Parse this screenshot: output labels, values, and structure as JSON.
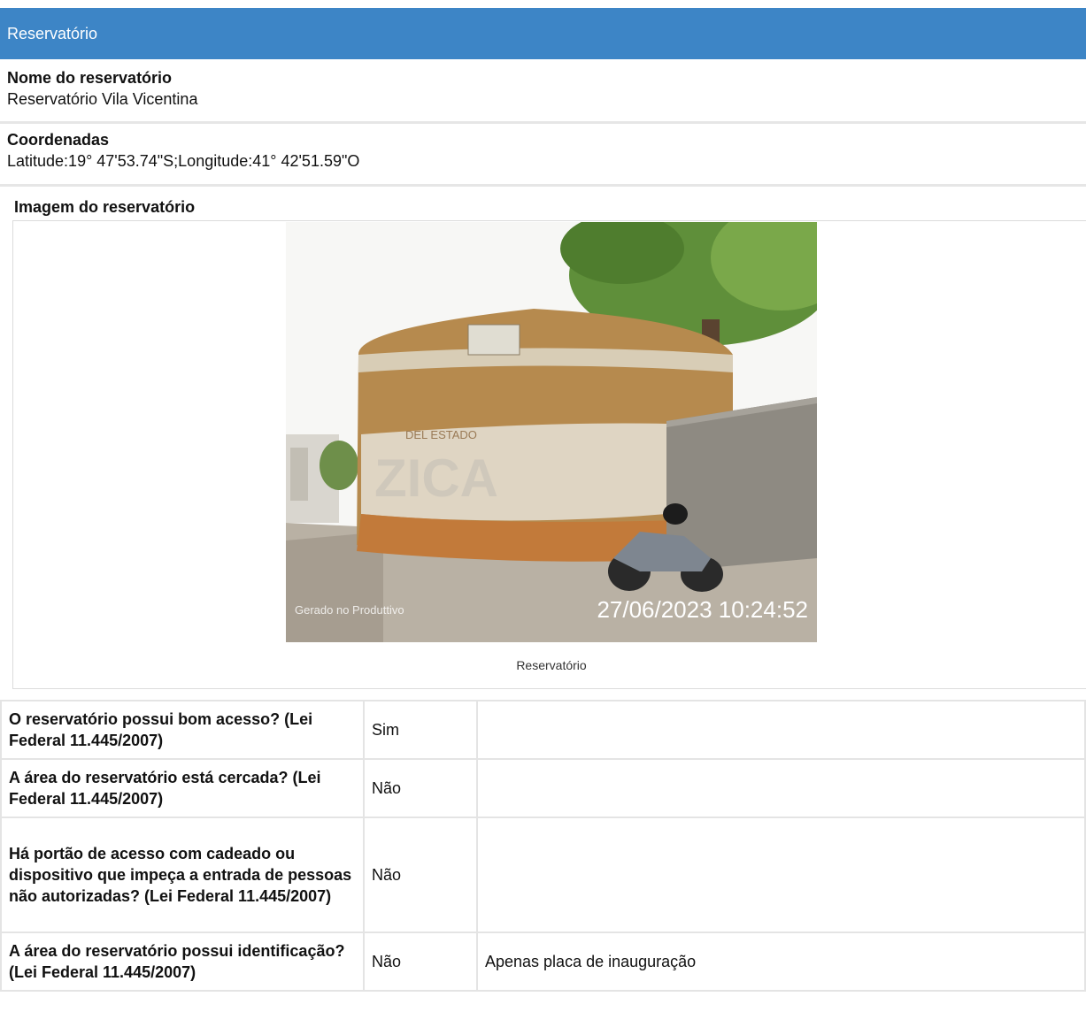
{
  "section": {
    "title": "Reservatório"
  },
  "fields": {
    "name": {
      "label": "Nome do reservatório",
      "value": "Reservatório Vila Vicentina"
    },
    "coords": {
      "label": "Coordenadas",
      "value": "Latitude:19° 47'53.74\"S;Longitude:41° 42'51.59\"O"
    }
  },
  "image": {
    "label": "Imagem do reservatório",
    "caption": "Reservatório",
    "watermark_left": "Gerado no Produttivo",
    "watermark_timestamp": "27/06/2023 10:24:52",
    "wall_text": "DEL ESTADO",
    "painted_text": "ZICA"
  },
  "questions": [
    {
      "question": "O reservatório possui bom acesso? (Lei Federal 11.445/2007)",
      "answer": "Sim",
      "note": ""
    },
    {
      "question": "A área do reservatório está cercada? (Lei Federal 11.445/2007)",
      "answer": "Não",
      "note": ""
    },
    {
      "question": "Há portão de acesso com cadeado ou dispositivo que impeça a entrada de pessoas não autorizadas? (Lei Federal 11.445/2007)",
      "answer": "Não",
      "note": ""
    },
    {
      "question": "A área do reservatório possui identificação? (Lei Federal 11.445/2007)",
      "answer": "Não",
      "note": "Apenas placa de inauguração"
    }
  ],
  "colors": {
    "header": "#3d85c6",
    "border": "#e4e4e4"
  }
}
